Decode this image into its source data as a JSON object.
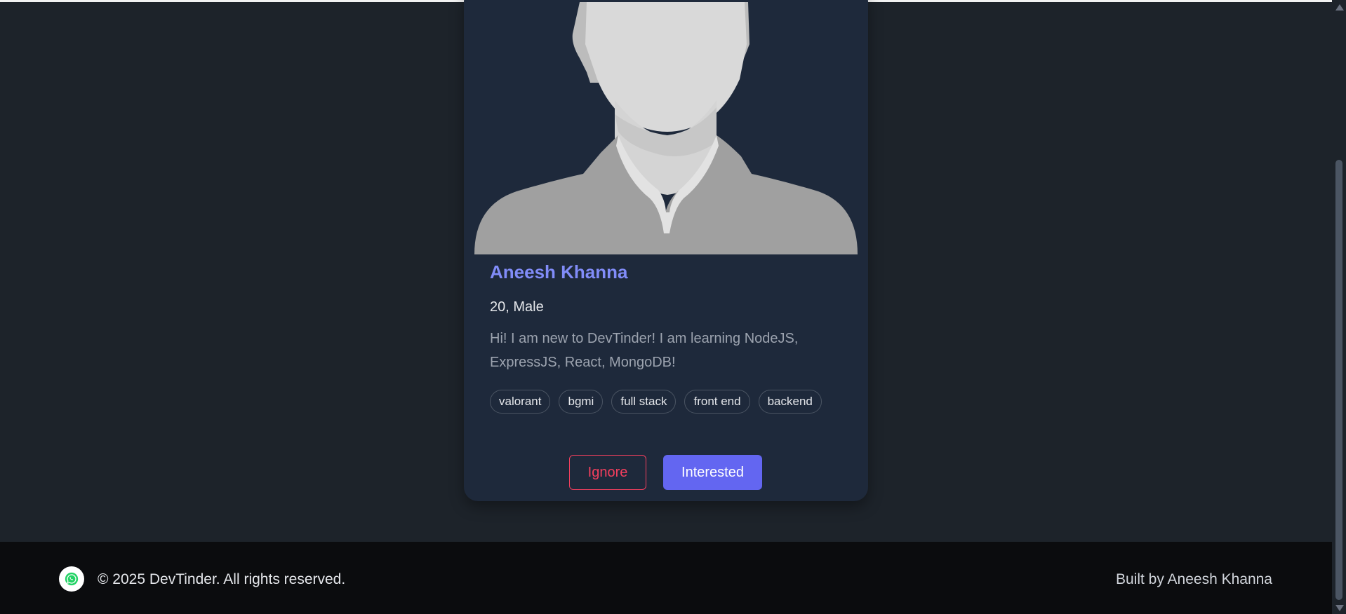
{
  "card": {
    "name": "Aneesh Khanna",
    "age_gender": "20, Male",
    "about": "Hi! I am new to DevTinder! I am learning NodeJS, ExpressJS, React, MongoDB!",
    "skills": [
      "valorant",
      "bgmi",
      "full stack",
      "front end",
      "backend"
    ],
    "avatar_icon": "default-user-silhouette",
    "actions": {
      "ignore_label": "Ignore",
      "interested_label": "Interested"
    }
  },
  "footer": {
    "icon": "whatsapp-icon",
    "copyright": "© 2025 DevTinder. All rights reserved.",
    "built_by": "Built by Aneesh Khanna"
  },
  "colors": {
    "background": "#1d232a",
    "card": "#1e293b",
    "name": "#818cf8",
    "primary": "#6366f1",
    "danger": "#f43f5e",
    "footer": "#0b0c0e"
  }
}
